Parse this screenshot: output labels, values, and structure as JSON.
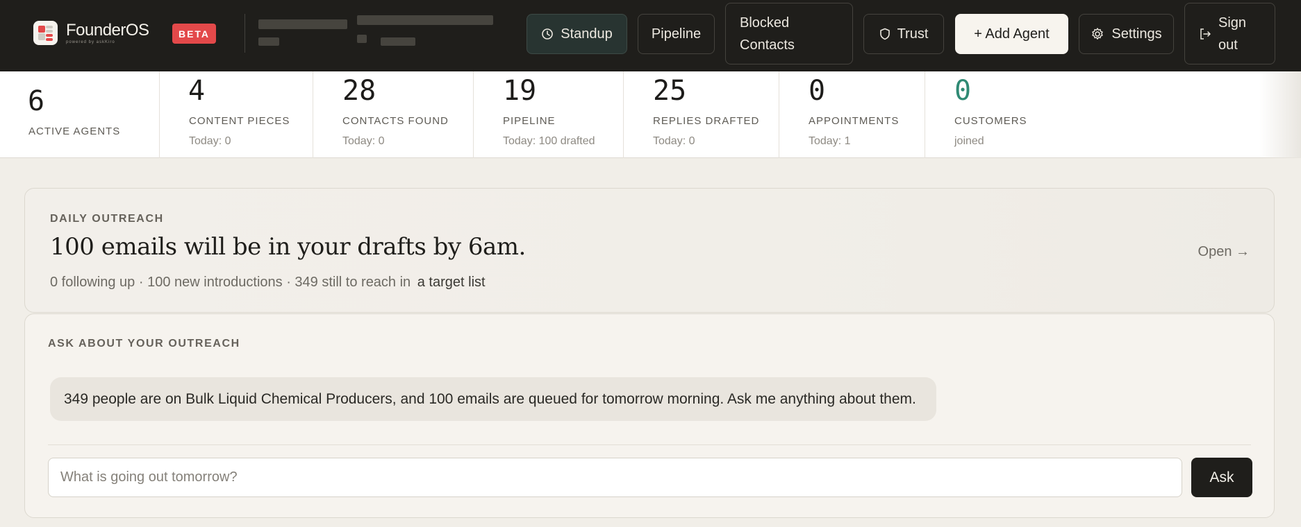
{
  "brand": {
    "name_a": "Founder",
    "name_b": "OS",
    "tagline": "powered by askKiro",
    "beta_label": "BETA"
  },
  "nav": {
    "standup": "Standup",
    "pipeline": "Pipeline",
    "blocked_contacts_line1": "Blocked",
    "blocked_contacts_line2": "Contacts",
    "trust": "Trust",
    "add_agent": "+ Add Agent",
    "settings": "Settings",
    "sign_out_line1": "Sign",
    "sign_out_line2": "out"
  },
  "stats": [
    {
      "value": "6",
      "label": "ACTIVE AGENTS",
      "sub": ""
    },
    {
      "value": "4",
      "label": "CONTENT PIECES",
      "sub": "Today: 0"
    },
    {
      "value": "28",
      "label": "CONTACTS FOUND",
      "sub": "Today: 0"
    },
    {
      "value": "19",
      "label": "PIPELINE",
      "sub": "Today: 100 drafted"
    },
    {
      "value": "25",
      "label": "REPLIES DRAFTED",
      "sub": "Today: 0"
    },
    {
      "value": "0",
      "label": "APPOINTMENTS",
      "sub": "Today: 1"
    },
    {
      "value": "0",
      "label": "CUSTOMERS",
      "sub": "joined"
    }
  ],
  "outreach": {
    "kicker": "DAILY OUTREACH",
    "headline": "100 emails will be in your drafts by 6am.",
    "sub": "0 following up · 100 new introductions · 349 still to reach in",
    "sub_link": "a target list",
    "open": "Open →"
  },
  "ask": {
    "kicker": "ASK ABOUT YOUR OUTREACH",
    "message": "349 people are on Bulk Liquid Chemical Producers, and 100 emails are queued for tomorrow morning. Ask me anything about them.",
    "input_placeholder": "What is going out tomorrow?",
    "button": "Ask"
  },
  "colors": {
    "topbar": "#1f1e1b",
    "beta": "#e3494a",
    "customers_accent": "#2f8a74",
    "background": "#f1eee8"
  }
}
